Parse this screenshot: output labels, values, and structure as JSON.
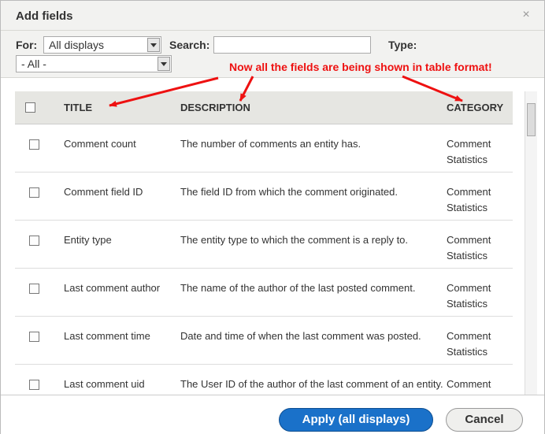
{
  "dialog": {
    "title": "Add fields",
    "close_glyph": "×"
  },
  "filters": {
    "for_label": "For:",
    "for_value": "All displays",
    "group_value": "- All -",
    "search_label": "Search:",
    "search_value": "",
    "type_label": "Type:"
  },
  "annotation": "Now all the fields are being shown in table format!",
  "annotation_color": "#ee1111",
  "table": {
    "headers": [
      "TITLE",
      "DESCRIPTION",
      "CATEGORY"
    ],
    "rows": [
      {
        "title": "Comment count",
        "description": "The number of comments an entity has.",
        "category": "Comment Statistics"
      },
      {
        "title": "Comment field ID",
        "description": "The field ID from which the comment originated.",
        "category": "Comment Statistics"
      },
      {
        "title": "Entity type",
        "description": "The entity type to which the comment is a reply to.",
        "category": "Comment Statistics"
      },
      {
        "title": "Last comment author",
        "description": "The name of the author of the last posted comment.",
        "category": "Comment Statistics"
      },
      {
        "title": "Last comment time",
        "description": "Date and time of when the last comment was posted.",
        "category": "Comment Statistics"
      },
      {
        "title": "Last comment uid",
        "description": "The User ID of the author of the last comment of an entity.",
        "category": "Comment Statistics"
      }
    ]
  },
  "buttons": {
    "apply": "Apply (all displays)",
    "cancel": "Cancel"
  },
  "colors": {
    "apply_button": "#1a71c9",
    "header_bg": "#e6e6e2"
  }
}
